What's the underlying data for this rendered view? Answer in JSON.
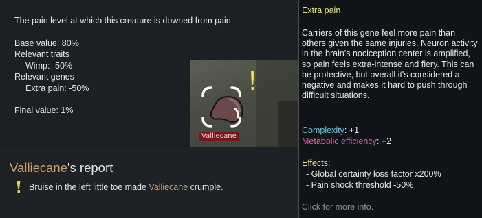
{
  "stat_tooltip": {
    "description": "The pain level at which this creature is downed from pain.",
    "base_value": "Base value: 80%",
    "traits_header": "Relevant traits",
    "trait_line": "Wimp: -50%",
    "genes_header": "Relevant genes",
    "gene_line": "Extra pain: -50%",
    "final_value": "Final value: 1%"
  },
  "world_view": {
    "pawn_label": "Valliecane"
  },
  "report": {
    "name": "Valliecane",
    "title_suffix": "'s report",
    "entry_prefix": "Bruise in the left little toe made ",
    "entry_name": "Valliecane",
    "entry_suffix": " crumple."
  },
  "gene_tooltip": {
    "title": "Extra pain",
    "description": "Carriers of this gene feel more pain than others given the same injuries. Neuron activity in the brain's nociception center is amplified, so pain feels extra-intense and fiery. This can be protective, but overall it's considered a negative and makes it hard to push through difficult situations.",
    "complexity_label": "Complexity",
    "complexity_value": ": +1",
    "metabolic_label": "Metabolic efficiency",
    "metabolic_value": ": +2",
    "effects_header": "Effects:",
    "effects": [
      "- Global certainty loss factor x200%",
      "- Pain shock threshold -50%"
    ],
    "more_info": "Click for more info."
  },
  "colors": {
    "title_yellow": "#e7e57a",
    "pawn_name": "#d2a26b",
    "complexity": "#6fc6e8",
    "metabolic": "#e060a0",
    "hint_gray": "#8f9296"
  }
}
